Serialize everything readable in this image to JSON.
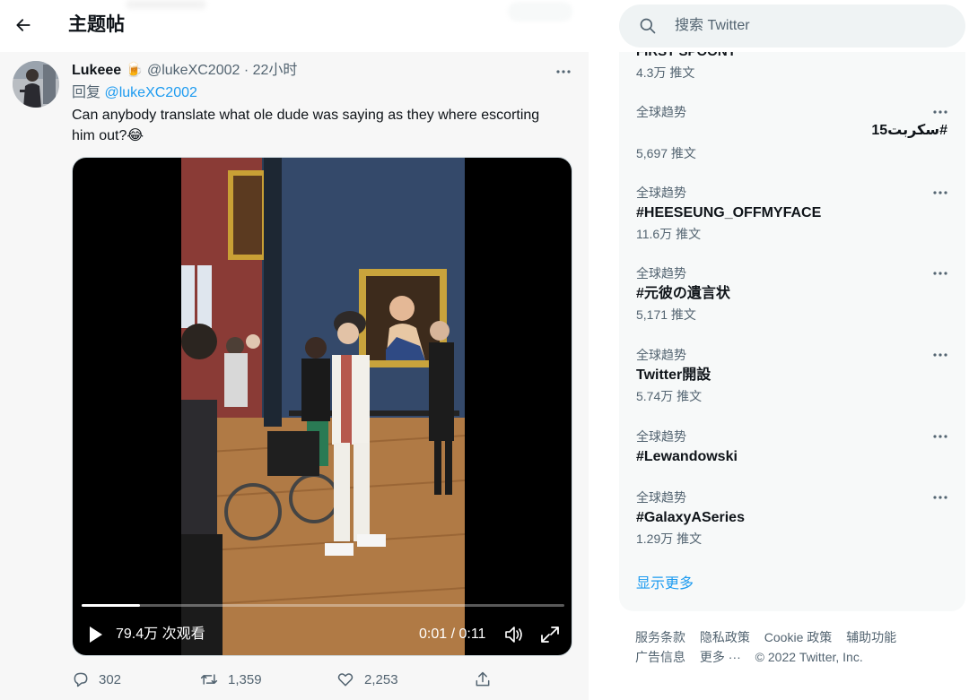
{
  "header": {
    "back_label": "←",
    "title": "主题帖"
  },
  "tweet": {
    "author_name": "Lukeee",
    "author_emoji": "🍺",
    "handle": "@lukeXC2002",
    "separator": "·",
    "time": "22小时",
    "reply_prefix": "回复",
    "reply_handle": "@lukeXC2002",
    "text": "Can anybody translate what ole dude was saying as they where escorting him out?😂",
    "more_icon": "more-horizontal-icon",
    "video": {
      "views": "79.4万 次观看",
      "time": "0:01 / 0:11",
      "progress": 0.12,
      "play_icon": "play-icon",
      "volume_icon": "volume-icon",
      "fullscreen_icon": "fullscreen-icon"
    },
    "actions": {
      "replies": "302",
      "retweets": "1,359",
      "likes": "2,253"
    }
  },
  "search": {
    "placeholder": "搜索 Twitter",
    "icon": "search-icon"
  },
  "trends": {
    "cut_off_name": "FIRST SPOONY",
    "cut_off_count": "4.3万 推文",
    "items": [
      {
        "context": "全球趋势",
        "name": "#سكربت15",
        "count": "5,697 推文"
      },
      {
        "context": "全球趋势",
        "name": "#HEESEUNG_OFFMYFACE",
        "count": "11.6万 推文"
      },
      {
        "context": "全球趋势",
        "name": "#元彼の遺言状",
        "count": "5,171 推文"
      },
      {
        "context": "全球趋势",
        "name": "Twitter開設",
        "count": "5.74万 推文"
      },
      {
        "context": "全球趋势",
        "name": "#Lewandowski",
        "count": ""
      },
      {
        "context": "全球趋势",
        "name": "#GalaxyASeries",
        "count": "1.29万 推文"
      }
    ],
    "show_more": "显示更多"
  },
  "footer": {
    "links": [
      "服务条款",
      "隐私政策",
      "Cookie 政策",
      "辅助功能",
      "广告信息",
      "更多 ···"
    ],
    "copyright": "© 2022 Twitter, Inc."
  },
  "colors": {
    "accent": "#1d9bf0",
    "text": "#0f1419",
    "muted": "#536471"
  }
}
